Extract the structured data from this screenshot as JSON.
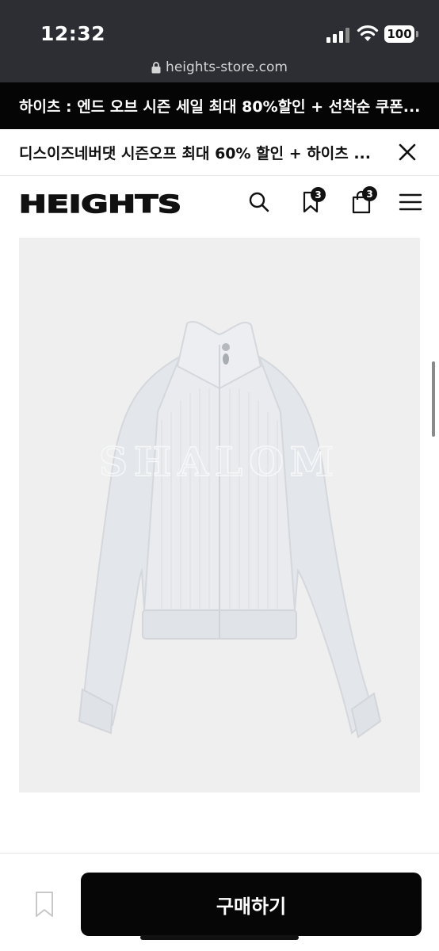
{
  "status_bar": {
    "time": "12:32",
    "battery": "100",
    "url": "heights-store.com"
  },
  "promo": {
    "dark_text": "하이츠 : 엔드 오브 시즌 세일 최대 80%할인 + 선착순 쿠폰...",
    "light_text": "디스이즈네버댓 시즌오프 최대 60% 할인 + 하이츠 ..."
  },
  "header": {
    "logo": "HEIGHTS",
    "wishlist_count": "3",
    "cart_count": "3"
  },
  "product": {
    "chest_lettering": "SHALOM"
  },
  "actions": {
    "buy_label": "구매하기"
  },
  "colors": {
    "status_bg": "#2c2e33",
    "banner_bg": "#050505",
    "button_bg": "#060606",
    "image_bg": "#efefef"
  }
}
